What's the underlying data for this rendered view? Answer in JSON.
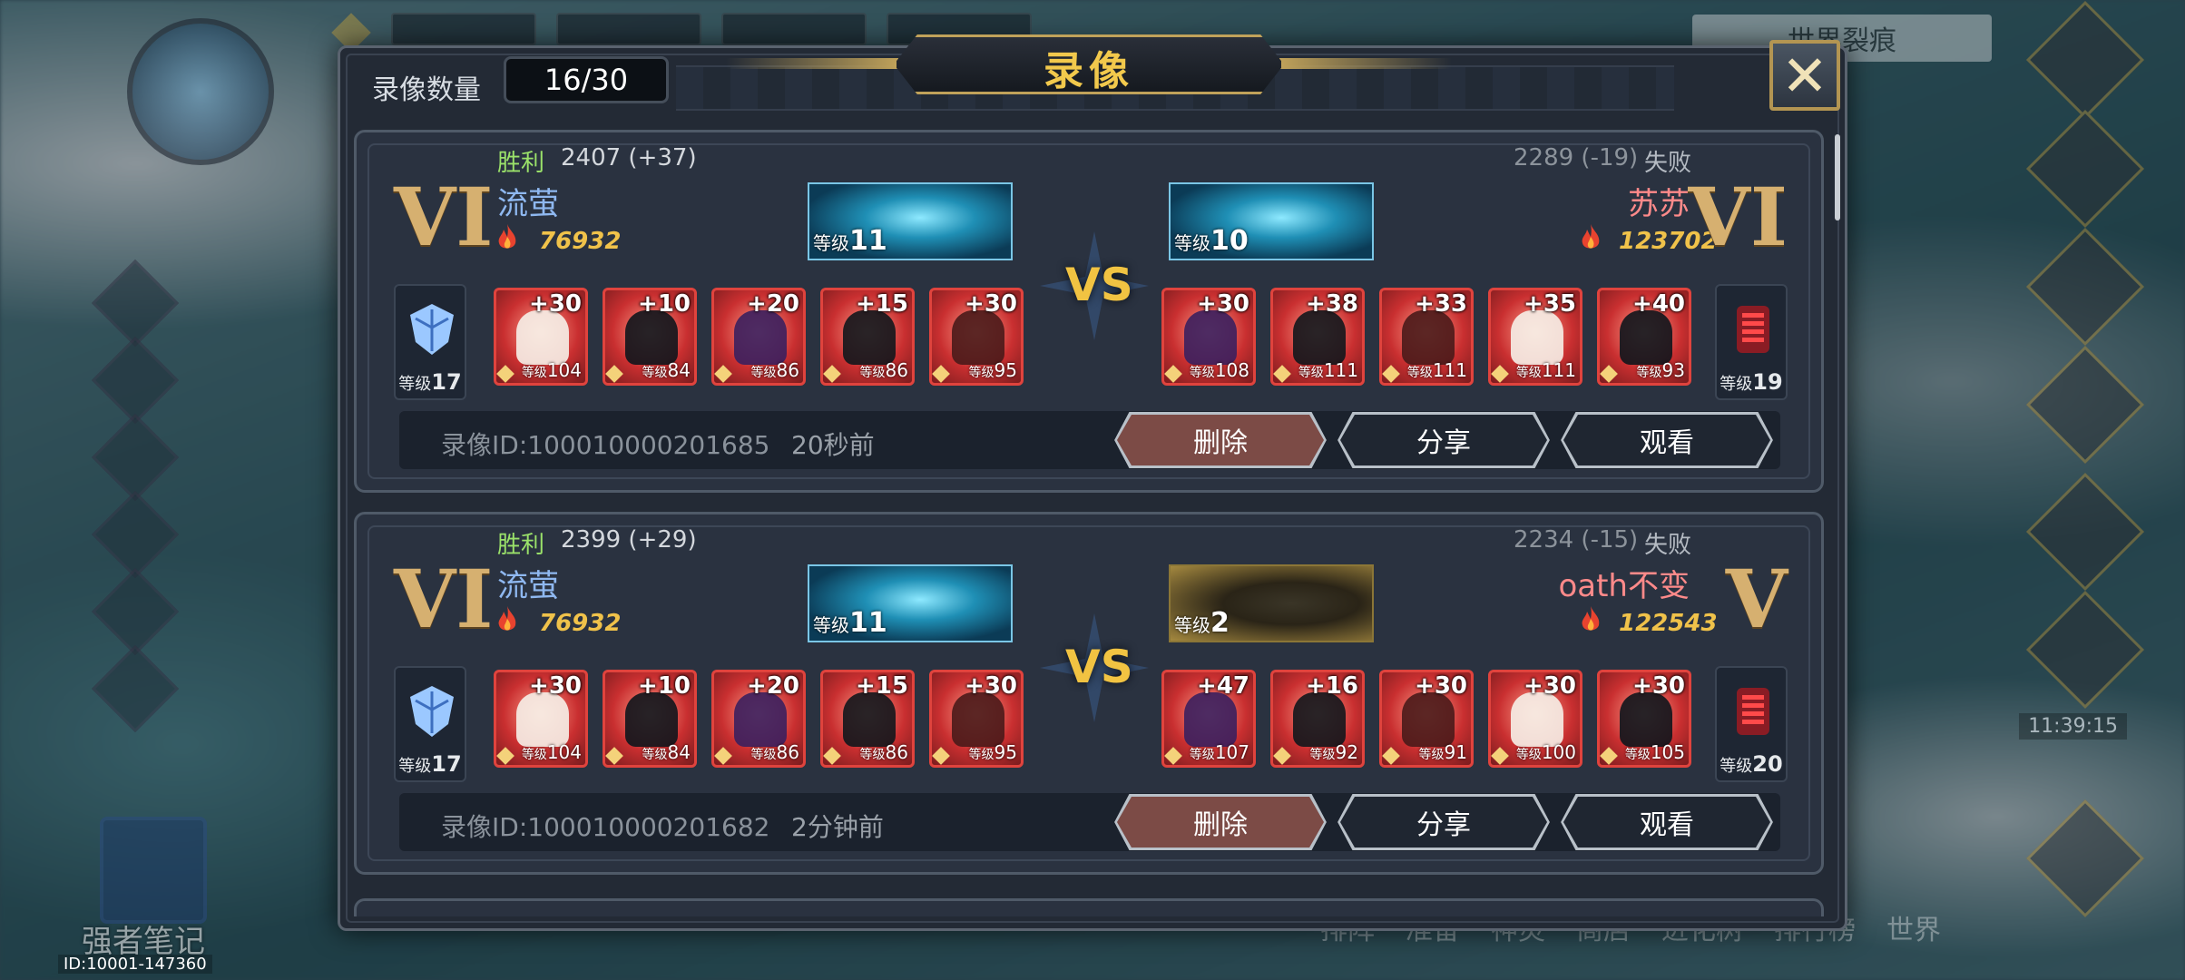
{
  "colors": {
    "accent_gold": "#f2c94c",
    "win_green": "#9be26a",
    "player_left": "#8fb8f0",
    "player_right": "#ff8a8a",
    "delete_button": "#7c4b46"
  },
  "background": {
    "left_label_blur": "强者笔记",
    "user_id": "ID:10001-147360",
    "clock": "11:39:15",
    "top_right_title": "世界裂痕",
    "bottom_nav": [
      "排阵",
      "准备",
      "神灵",
      "商店",
      "进化树",
      "排行榜",
      "世界"
    ]
  },
  "dialog": {
    "title": "录像",
    "count_label": "录像数量",
    "count_value": "16/30",
    "close_icon": "close-icon"
  },
  "matches": [
    {
      "left": {
        "result": "胜利",
        "score": "2407 (+37)",
        "name": "流萤",
        "power": "76932",
        "rank": "VI",
        "banner_level_label": "等级",
        "banner_level": "11",
        "shield_level_label": "等级",
        "shield_level": "17",
        "units": [
          {
            "plus": "+30",
            "level": "104"
          },
          {
            "plus": "+10",
            "level": "84"
          },
          {
            "plus": "+20",
            "level": "86"
          },
          {
            "plus": "+15",
            "level": "86"
          },
          {
            "plus": "+30",
            "level": "95"
          }
        ]
      },
      "vs": "VS",
      "right": {
        "result": "失败",
        "score": "2289 (-19)",
        "name": "苏苏",
        "power": "123702",
        "rank": "VI",
        "banner_level_label": "等级",
        "banner_level": "10",
        "shield_level_label": "等级",
        "shield_level": "19",
        "units": [
          {
            "plus": "+30",
            "level": "108"
          },
          {
            "plus": "+38",
            "level": "111"
          },
          {
            "plus": "+33",
            "level": "111"
          },
          {
            "plus": "+35",
            "level": "111"
          },
          {
            "plus": "+40",
            "level": "93"
          }
        ]
      },
      "replay_id": "录像ID:100010000201685",
      "time_ago": "20秒前",
      "buttons": {
        "delete": "删除",
        "share": "分享",
        "watch": "观看"
      }
    },
    {
      "left": {
        "result": "胜利",
        "score": "2399 (+29)",
        "name": "流萤",
        "power": "76932",
        "rank": "VI",
        "banner_level_label": "等级",
        "banner_level": "11",
        "shield_level_label": "等级",
        "shield_level": "17",
        "units": [
          {
            "plus": "+30",
            "level": "104"
          },
          {
            "plus": "+10",
            "level": "84"
          },
          {
            "plus": "+20",
            "level": "86"
          },
          {
            "plus": "+15",
            "level": "86"
          },
          {
            "plus": "+30",
            "level": "95"
          }
        ]
      },
      "vs": "VS",
      "right": {
        "result": "失败",
        "score": "2234 (-15)",
        "name": "oath不变",
        "power": "122543",
        "rank": "V",
        "banner_level_label": "等级",
        "banner_level": "2",
        "shield_level_label": "等级",
        "shield_level": "20",
        "units": [
          {
            "plus": "+47",
            "level": "107"
          },
          {
            "plus": "+16",
            "level": "92"
          },
          {
            "plus": "+30",
            "level": "91"
          },
          {
            "plus": "+30",
            "level": "100"
          },
          {
            "plus": "+30",
            "level": "105"
          }
        ]
      },
      "replay_id": "录像ID:100010000201682",
      "time_ago": "2分钟前",
      "buttons": {
        "delete": "删除",
        "share": "分享",
        "watch": "观看"
      }
    }
  ]
}
